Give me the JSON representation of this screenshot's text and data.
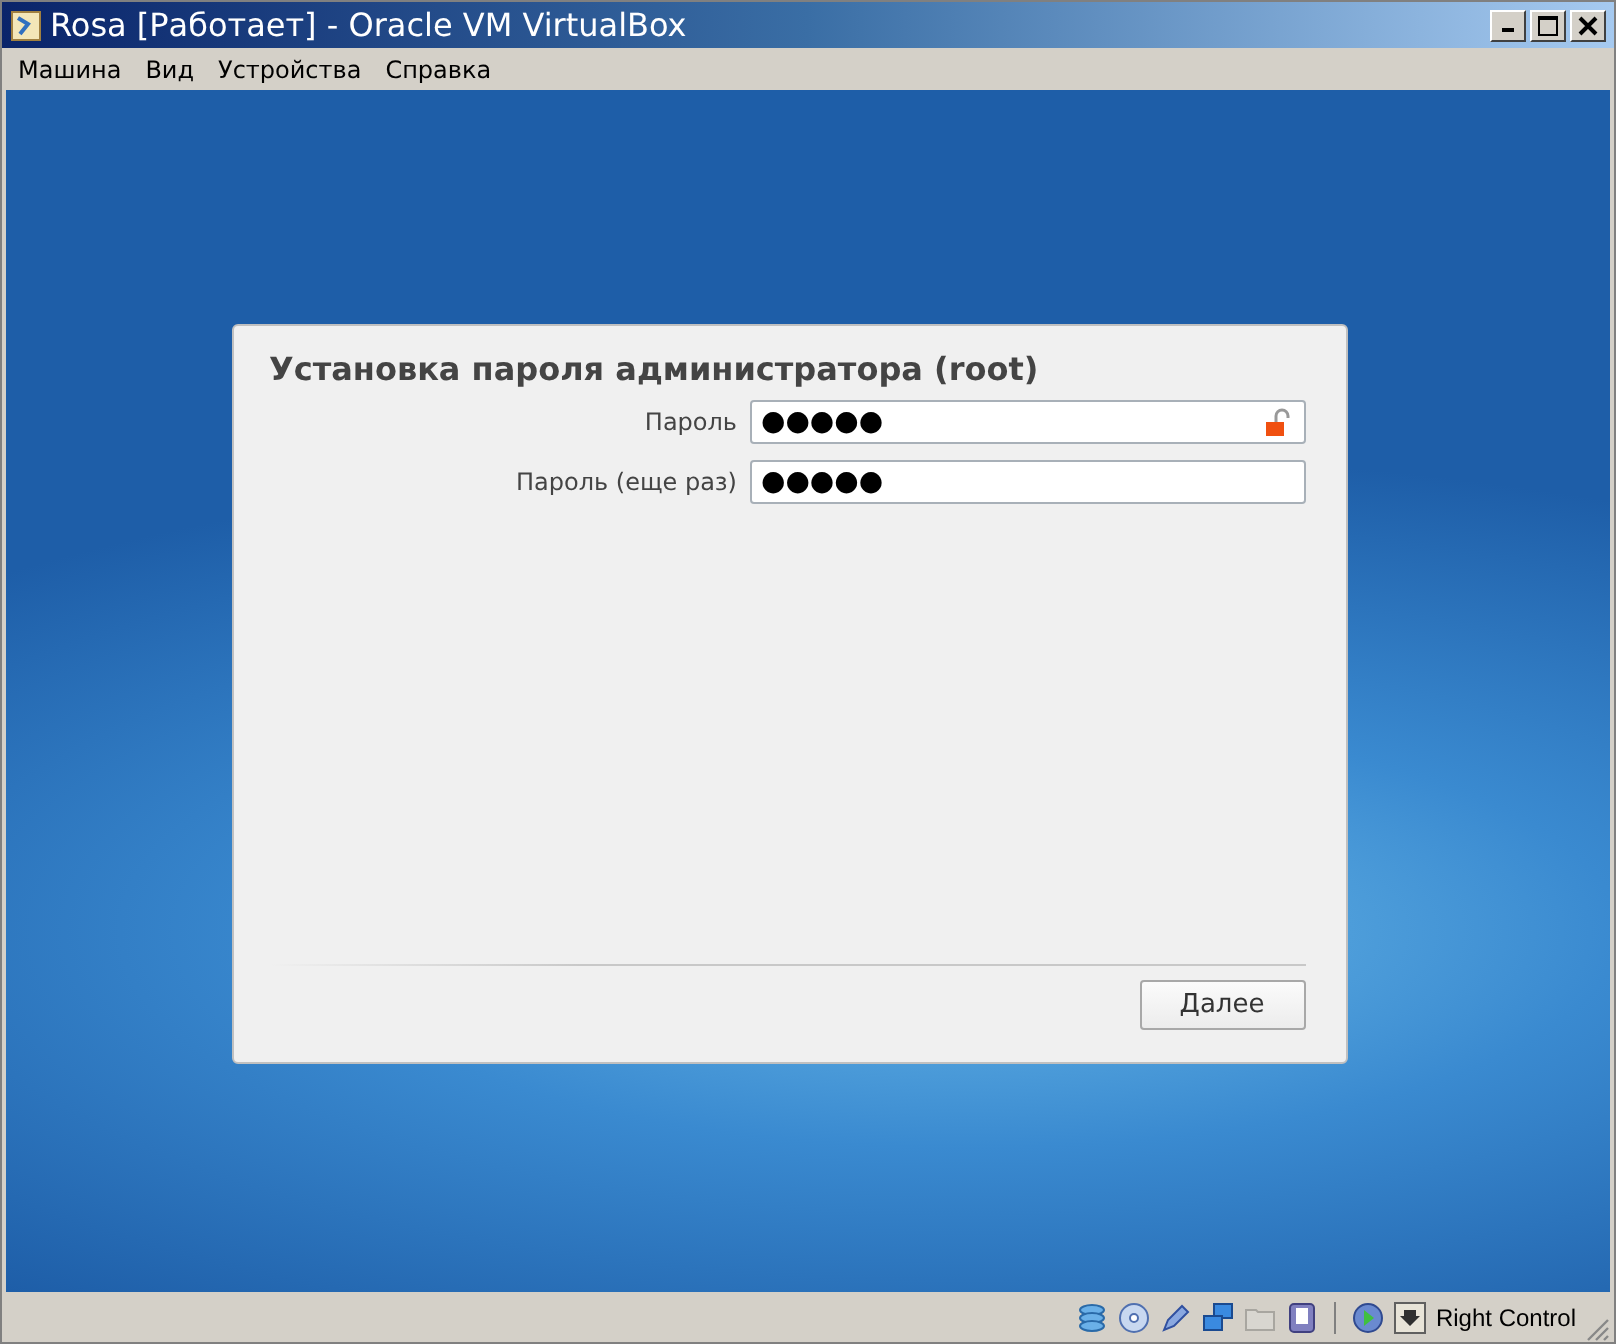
{
  "window": {
    "title": "Rosa [Работает] - Oracle VM VirtualBox"
  },
  "menu": [
    "Машина",
    "Вид",
    "Устройства",
    "Справка"
  ],
  "dialog": {
    "title": "Установка пароля администратора (root)",
    "fields": [
      {
        "label": "Пароль",
        "value": "●●●●●",
        "lock_icon": true
      },
      {
        "label": "Пароль (еще раз)",
        "value": "●●●●●",
        "lock_icon": false
      }
    ],
    "next_button": "Далее"
  },
  "status_bar": {
    "host_key": "Right Control"
  }
}
